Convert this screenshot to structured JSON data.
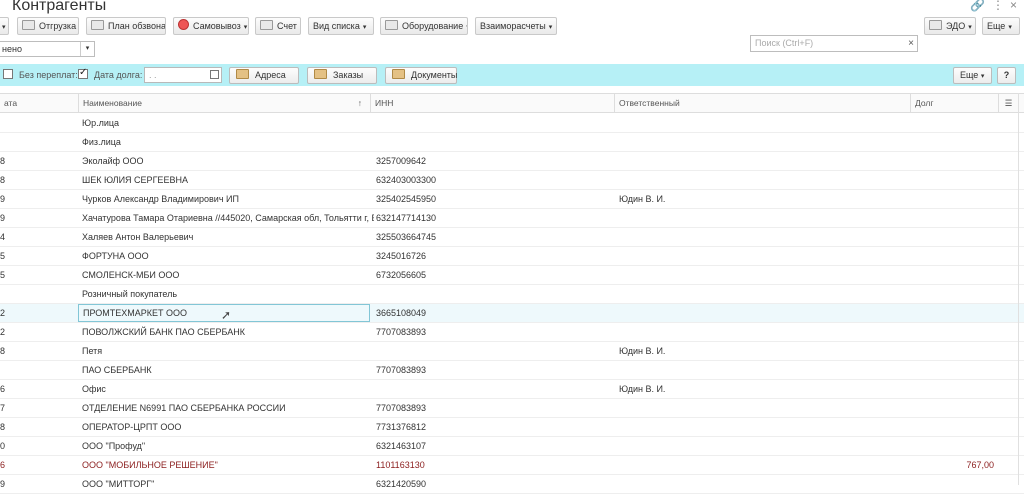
{
  "title": "Контрагенты",
  "toolbar": {
    "buttons": [
      "Отгрузка",
      "План обзвона",
      "Самовывоз",
      "Счет",
      "Вид списка",
      "Оборудование",
      "Взаиморасчеты",
      "ЭДО",
      "Еще"
    ],
    "search_placeholder": "Поиск (Ctrl+F)",
    "search_clear": "×"
  },
  "filter": {
    "value": "нено"
  },
  "cyanbar": {
    "no_overpay_label": "Без переплат:",
    "debt_date_label": "Дата долга:",
    "debt_date_value": " . .",
    "debt_date_checked": true,
    "no_overpay_checked": false,
    "addresses": "Адреса",
    "orders": "Заказы",
    "documents": "Документы",
    "more": "Еще",
    "help": "?"
  },
  "table": {
    "headers": [
      "ата",
      "Наименование",
      "ИНН",
      "Ответственный",
      "Долг"
    ],
    "sort_indicator": "↑",
    "rows": [
      {
        "d": "",
        "name": "Юр.лица",
        "inn": "",
        "resp": "",
        "debt": ""
      },
      {
        "d": "",
        "name": "Физ.лица",
        "inn": "",
        "resp": "",
        "debt": ""
      },
      {
        "d": "8",
        "name": "Эколайф ООО",
        "inn": "3257009642",
        "resp": "",
        "debt": ""
      },
      {
        "d": "8",
        "name": "ШЕК ЮЛИЯ СЕРГЕЕВНА",
        "inn": "632403003300",
        "resp": "",
        "debt": ""
      },
      {
        "d": "9",
        "name": "Чурков Александр Владимирович ИП",
        "inn": "325402545950",
        "resp": "Юдин В. И.",
        "debt": ""
      },
      {
        "d": "9",
        "name": "Хачатурова Тамара Отариевна //445020, Самарская обл, Тольятти г, Б...",
        "inn": "632147714130",
        "resp": "",
        "debt": ""
      },
      {
        "d": "4",
        "name": "Халяев Антон Валерьевич",
        "inn": "325503664745",
        "resp": "",
        "debt": ""
      },
      {
        "d": "5",
        "name": "ФОРТУНА ООО",
        "inn": "3245016726",
        "resp": "",
        "debt": ""
      },
      {
        "d": "5",
        "name": "СМОЛЕНСК-МБИ ООО",
        "inn": "6732056605",
        "resp": "",
        "debt": ""
      },
      {
        "d": "",
        "name": "Розничный покупатель",
        "inn": "",
        "resp": "",
        "debt": ""
      },
      {
        "d": "2",
        "name": "ПРОМТЕХМАРКЕТ ООО",
        "inn": "3665108049",
        "resp": "",
        "debt": ""
      },
      {
        "d": "2",
        "name": "ПОВОЛЖСКИЙ БАНК ПАО СБЕРБАНК",
        "inn": "7707083893",
        "resp": "",
        "debt": ""
      },
      {
        "d": "8",
        "name": "Петя",
        "inn": "",
        "resp": "Юдин В. И.",
        "debt": ""
      },
      {
        "d": "",
        "name": "ПАО СБЕРБАНК",
        "inn": "7707083893",
        "resp": "",
        "debt": ""
      },
      {
        "d": "6",
        "name": "Офис",
        "inn": "",
        "resp": "Юдин В. И.",
        "debt": ""
      },
      {
        "d": "7",
        "name": "ОТДЕЛЕНИЕ N6991 ПАО СБЕРБАНКА РОССИИ",
        "inn": "7707083893",
        "resp": "",
        "debt": ""
      },
      {
        "d": "8",
        "name": "ОПЕРАТОР-ЦРПТ ООО",
        "inn": "7731376812",
        "resp": "",
        "debt": ""
      },
      {
        "d": "0",
        "name": "ООО \"Профуд\"",
        "inn": "6321463107",
        "resp": "",
        "debt": ""
      },
      {
        "d": "6",
        "name": "ООО \"МОБИЛЬНОЕ РЕШЕНИЕ\"",
        "inn": "1101163130",
        "resp": "",
        "debt": "767,00"
      },
      {
        "d": "9",
        "name": "ООО \"МИТТОРГ\"",
        "inn": "6321420590",
        "resp": "",
        "debt": ""
      }
    ],
    "selected_row": 10,
    "red_row": 18
  }
}
